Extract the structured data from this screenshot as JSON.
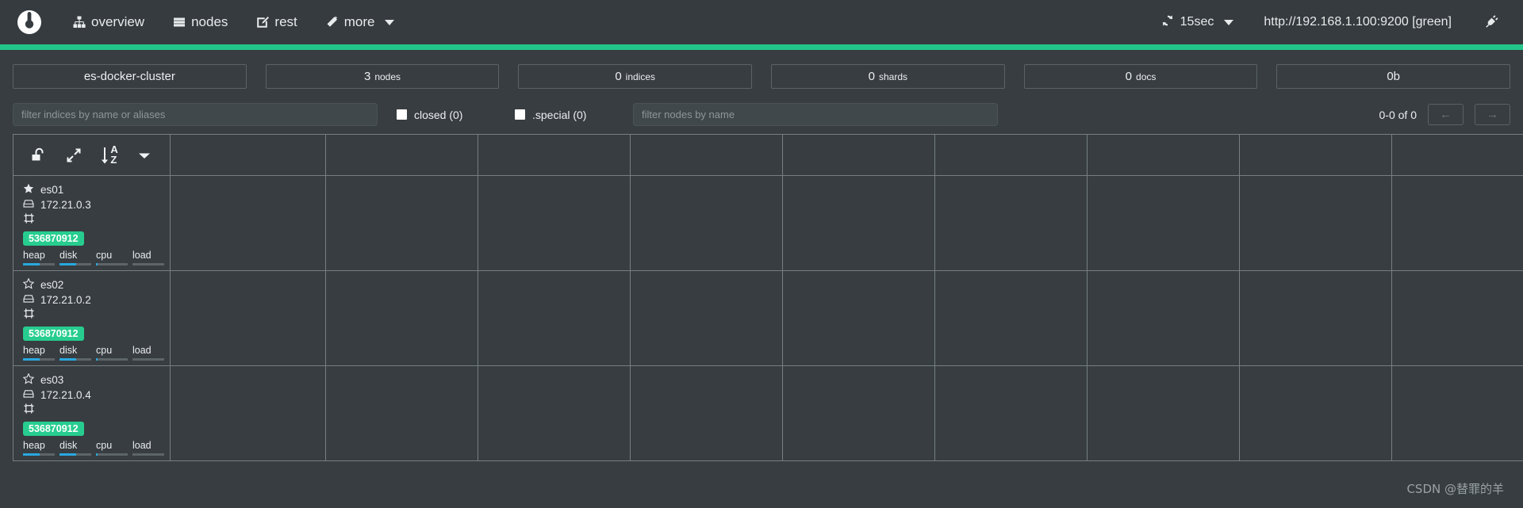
{
  "navbar": {
    "logo_name": "elasticsearch-head-logo",
    "items": [
      {
        "label": "overview",
        "icon": "sitemap-icon"
      },
      {
        "label": "nodes",
        "icon": "server-list-icon"
      },
      {
        "label": "rest",
        "icon": "edit-square-icon"
      },
      {
        "label": "more",
        "icon": "magic-wand-icon",
        "has_caret": true
      }
    ],
    "refresh": {
      "icon": "refresh-icon",
      "label": "15sec",
      "has_caret": true
    },
    "cluster_url": "http://192.168.1.100:9200 [green]",
    "connect_icon": "plug-icon",
    "accent_color": "#23c68a"
  },
  "stats": [
    {
      "value": "",
      "label": "es-docker-cluster",
      "single": true
    },
    {
      "value": "3",
      "label": "nodes"
    },
    {
      "value": "0",
      "label": "indices"
    },
    {
      "value": "0",
      "label": "shards"
    },
    {
      "value": "0",
      "label": "docs"
    },
    {
      "value": "",
      "label": "0b",
      "single": true
    }
  ],
  "filters": {
    "index_filter_placeholder": "filter indices by name or aliases",
    "index_filter_value": "",
    "closed_label": "closed (0)",
    "closed_checked": false,
    "special_label": ".special (0)",
    "special_checked": false,
    "node_filter_placeholder": "filter nodes by name",
    "node_filter_value": "",
    "pager_count": "0-0 of 0",
    "prev_label": "←",
    "next_label": "→"
  },
  "table": {
    "tools": [
      {
        "name": "unlock-icon",
        "title": "unlock"
      },
      {
        "name": "expand-arrows-icon",
        "title": "expand"
      },
      {
        "name": "sort-alpha-asc-icon",
        "title": "sort A-Z",
        "letters": [
          "A",
          "Z"
        ]
      },
      {
        "name": "chevron-down-icon",
        "title": "more"
      }
    ],
    "empty_columns": 6,
    "nodes": [
      {
        "name": "es01",
        "master": true,
        "star_icon": "star-filled-icon",
        "ip": "172.21.0.3",
        "host_icon": "hdd-icon",
        "action_icon": "shutdown-node-icon",
        "heap_badge": "536870912",
        "metrics": [
          {
            "label": "heap",
            "percent": 52
          },
          {
            "label": "disk",
            "percent": 52
          },
          {
            "label": "cpu",
            "percent": 6
          },
          {
            "label": "load",
            "percent": 0
          }
        ]
      },
      {
        "name": "es02",
        "master": false,
        "star_icon": "star-outline-icon",
        "ip": "172.21.0.2",
        "host_icon": "hdd-icon",
        "action_icon": "shutdown-node-icon",
        "heap_badge": "536870912",
        "metrics": [
          {
            "label": "heap",
            "percent": 52
          },
          {
            "label": "disk",
            "percent": 52
          },
          {
            "label": "cpu",
            "percent": 6
          },
          {
            "label": "load",
            "percent": 0
          }
        ]
      },
      {
        "name": "es03",
        "master": false,
        "star_icon": "star-outline-icon",
        "ip": "172.21.0.4",
        "host_icon": "hdd-icon",
        "action_icon": "shutdown-node-icon",
        "heap_badge": "536870912",
        "metrics": [
          {
            "label": "heap",
            "percent": 52
          },
          {
            "label": "disk",
            "percent": 52
          },
          {
            "label": "cpu",
            "percent": 6
          },
          {
            "label": "load",
            "percent": 0
          }
        ]
      }
    ]
  },
  "watermark": "CSDN @替罪的羊"
}
